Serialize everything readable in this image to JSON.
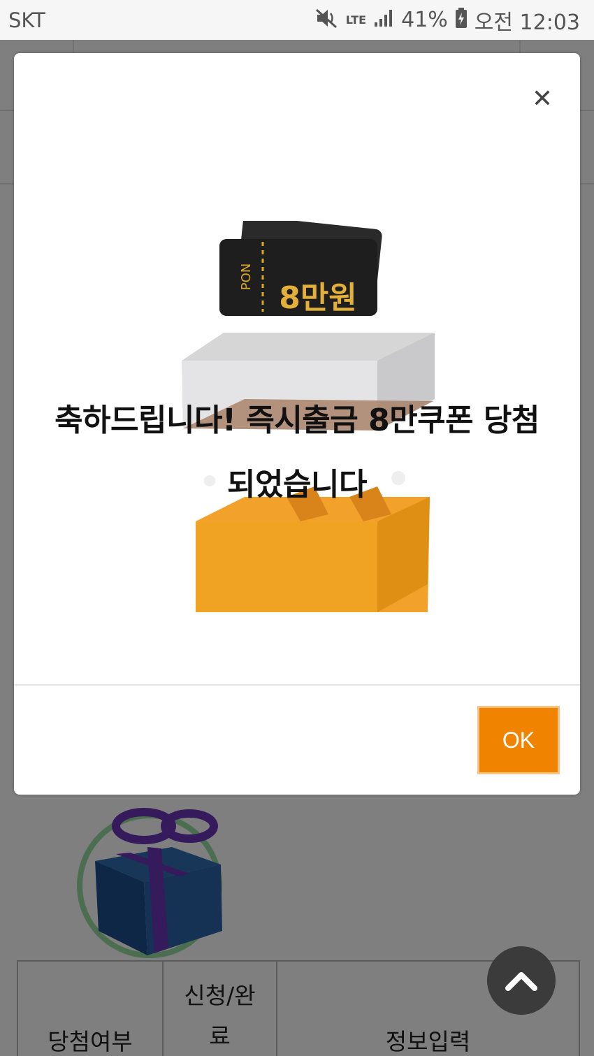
{
  "status_bar": {
    "carrier": "SKT",
    "network": "LTE",
    "battery": "41%",
    "time": "오전 12:03",
    "icons": [
      "mute-icon",
      "lte-icon",
      "signal-icon",
      "battery-icon"
    ]
  },
  "modal": {
    "message_line1": "축하드립니다! 즉시출금 8만쿠폰 당첨",
    "message_line2": "되었습니다",
    "coupon_tag": "PON",
    "coupon_amount": "8만원",
    "ok_label": "OK",
    "accent_color": "#f08300"
  },
  "table": {
    "col1": "당첨여부",
    "col2_line1": "신청/완",
    "col2_line2": "료",
    "col3": "정보입력"
  }
}
